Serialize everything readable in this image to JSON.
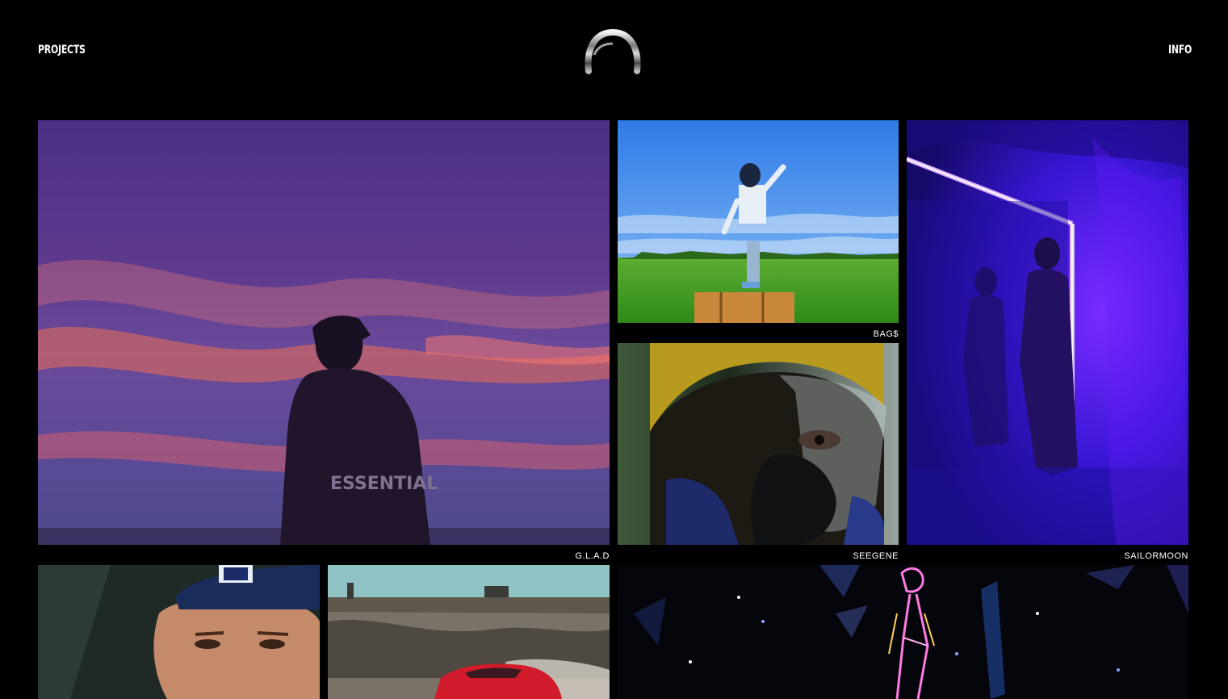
{
  "header": {
    "nav_left": "PROJECTS",
    "nav_right": "INFO",
    "logo_icon": "chrome-ring-logo-icon"
  },
  "projects": [
    {
      "title": "G.L.A.D",
      "shirt_text": "ESSENTIAL"
    },
    {
      "title": "BAG$"
    },
    {
      "title": "SEEGENE"
    },
    {
      "title": "SAILORMOON"
    },
    {
      "title": ""
    },
    {
      "title": ""
    },
    {
      "title": ""
    }
  ],
  "colors": {
    "background": "#000000",
    "text": "#ffffff",
    "glad_sky_top": "#4b2f86",
    "glad_sky_glow": "#e06a5a",
    "bags_sky": "#3f8ff0",
    "bags_grass": "#3f9a22",
    "sailor_neon": "#5a18ff",
    "seegene_yellow": "#b79a1e",
    "space_neon": "#ff7ae0"
  }
}
